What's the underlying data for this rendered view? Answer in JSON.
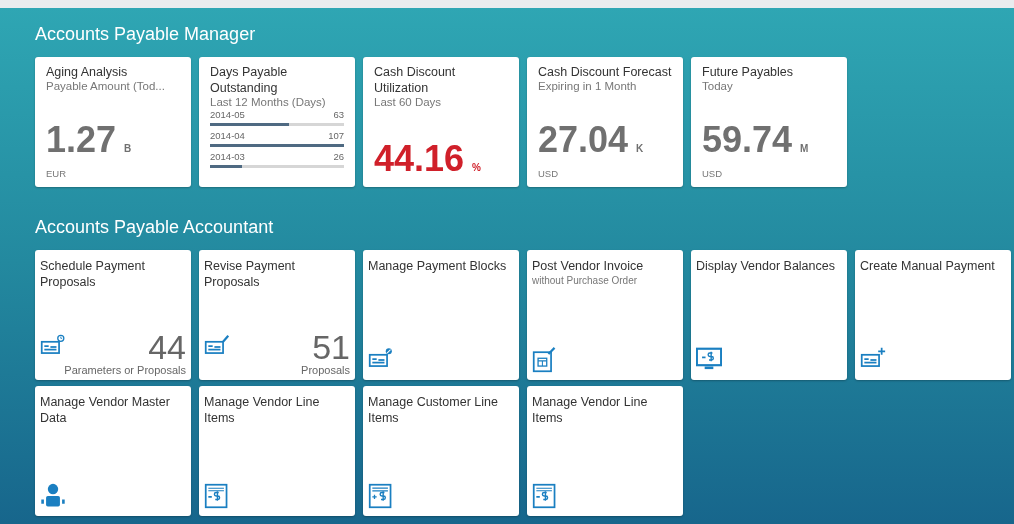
{
  "groups": [
    {
      "title": "Accounts Payable Manager",
      "tiles": [
        {
          "kind": "kpi",
          "title": "Aging Analysis",
          "subtitle": "Payable Amount (Tod...",
          "value": "1.27",
          "scale": "B",
          "color": "#707070",
          "footer": "EUR"
        },
        {
          "kind": "comparison",
          "title": "Days Payable Outstanding",
          "subtitle": "Last 12 Months (Days)",
          "rows": [
            {
              "label": "2014-05",
              "value": "63",
              "level": 0.59
            },
            {
              "label": "2014-04",
              "value": "107",
              "level": 1.0
            },
            {
              "label": "2014-03",
              "value": "26",
              "level": 0.24
            }
          ]
        },
        {
          "kind": "kpi",
          "title": "Cash Discount Utilization",
          "subtitle": "Last 60 Days",
          "value": "44.16",
          "scale": "%",
          "color": "#d0202a"
        },
        {
          "kind": "kpi",
          "title": "Cash Discount Forecast",
          "subtitle": "Expiring in 1 Month",
          "value": "27.04",
          "scale": "K",
          "color": "#707070",
          "footer": "USD"
        },
        {
          "kind": "kpi",
          "title": "Future Payables",
          "subtitle": "Today",
          "value": "59.74",
          "scale": "M",
          "color": "#707070",
          "footer": "USD"
        }
      ]
    },
    {
      "title": "Accounts Payable Accountant",
      "tiles": [
        {
          "kind": "launch",
          "title": "Schedule Payment Proposals",
          "number": "44",
          "number_label": "Parameters or Proposals"
        },
        {
          "kind": "launch",
          "title": "Revise Payment Proposals",
          "number": "51",
          "number_label": "Proposals"
        },
        {
          "kind": "launch",
          "title": "Manage Payment Blocks"
        },
        {
          "kind": "launch",
          "title": "Post Vendor Invoice",
          "subtitle": "without Purchase Order"
        },
        {
          "kind": "launch",
          "title": "Display Vendor Balances"
        },
        {
          "kind": "launch",
          "title": "Create Manual Payment"
        },
        {
          "kind": "launch",
          "title": "Manage Vendor Master Data"
        },
        {
          "kind": "launch",
          "title": "Manage Vendor Line Items"
        },
        {
          "kind": "launch",
          "title": "Manage Customer Line Items"
        },
        {
          "kind": "launch",
          "title": "Manage Vendor Line Items"
        }
      ]
    }
  ]
}
